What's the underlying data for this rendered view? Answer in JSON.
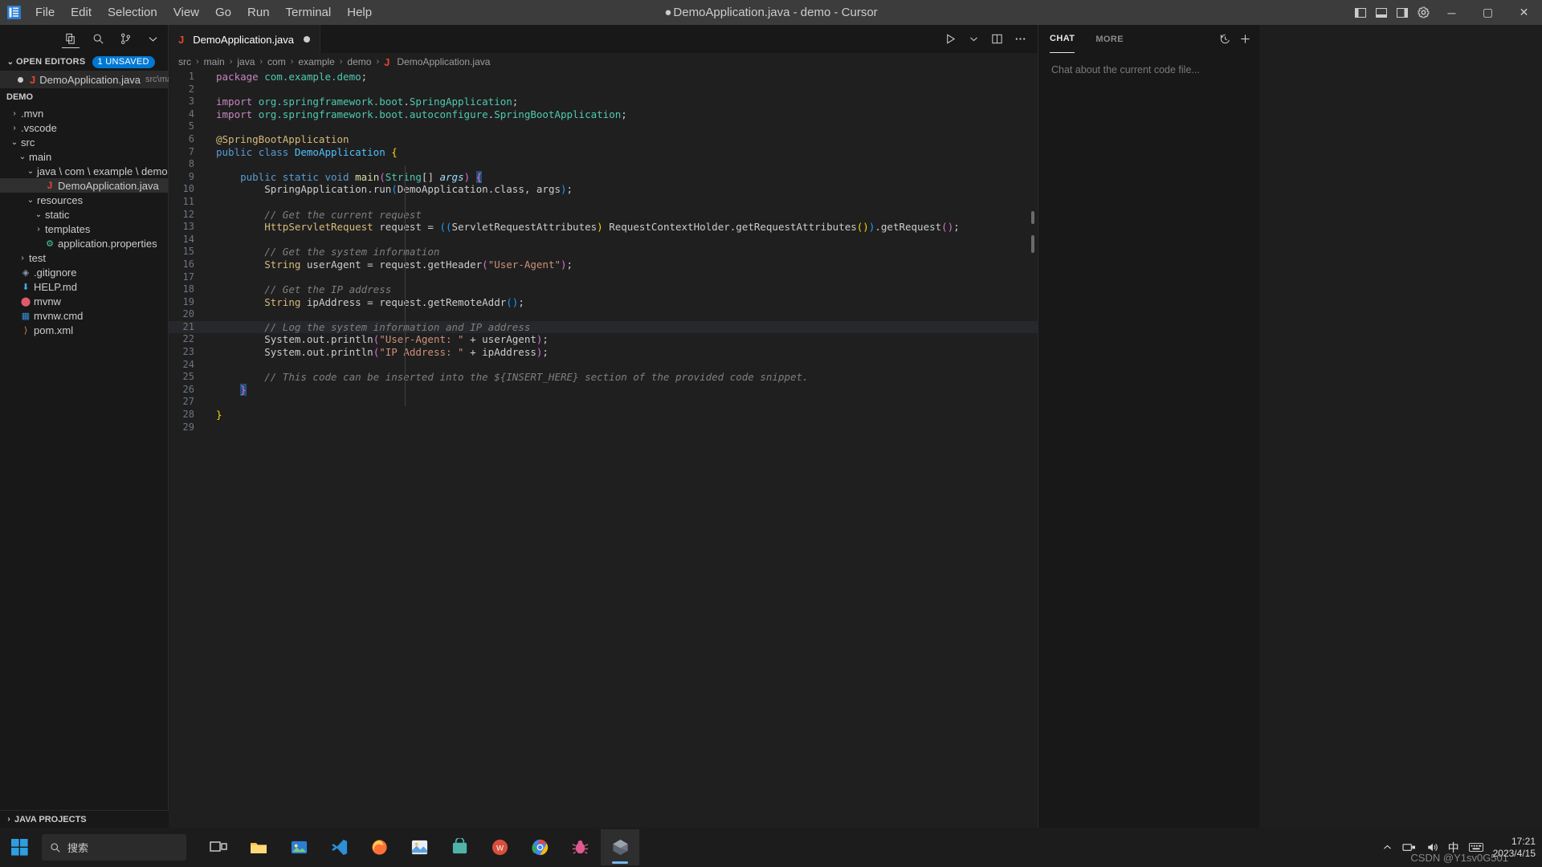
{
  "window": {
    "title": "DemoApplication.java - demo - Cursor",
    "dirty_marker": "●",
    "menu": [
      "File",
      "Edit",
      "Selection",
      "View",
      "Go",
      "Run",
      "Terminal",
      "Help"
    ],
    "controls": {
      "minimize": "─",
      "maximize": "▢",
      "close": "✕"
    }
  },
  "sidebar": {
    "tools": [
      "new-file-icon",
      "search-icon",
      "source-control-icon",
      "more-icon"
    ],
    "open_editors": {
      "title": "OPEN EDITORS",
      "badge": "1 unsaved",
      "items": [
        {
          "name": "DemoApplication.java",
          "path_hint": "src\\main\\...",
          "dirty": true
        }
      ]
    },
    "project": {
      "root": "DEMO",
      "tree": [
        {
          "label": ".mvn",
          "type": "folder",
          "expanded": false,
          "depth": 1
        },
        {
          "label": ".vscode",
          "type": "folder",
          "expanded": false,
          "depth": 1
        },
        {
          "label": "src",
          "type": "folder",
          "expanded": true,
          "depth": 1
        },
        {
          "label": "main",
          "type": "folder",
          "expanded": true,
          "depth": 2
        },
        {
          "label": "java \\ com \\ example \\ demo",
          "type": "folder",
          "expanded": true,
          "depth": 3
        },
        {
          "label": "DemoApplication.java",
          "type": "java",
          "expanded": false,
          "depth": 4,
          "selected": true
        },
        {
          "label": "resources",
          "type": "folder",
          "expanded": true,
          "depth": 3
        },
        {
          "label": "static",
          "type": "folder",
          "expanded": true,
          "depth": 4
        },
        {
          "label": "templates",
          "type": "folder",
          "expanded": false,
          "depth": 4
        },
        {
          "label": "application.properties",
          "type": "properties",
          "expanded": false,
          "depth": 4
        },
        {
          "label": "test",
          "type": "folder",
          "expanded": false,
          "depth": 2
        },
        {
          "label": ".gitignore",
          "type": "git",
          "expanded": false,
          "depth": 1
        },
        {
          "label": "HELP.md",
          "type": "markdown",
          "expanded": false,
          "depth": 1
        },
        {
          "label": "mvnw",
          "type": "maven",
          "expanded": false,
          "depth": 1
        },
        {
          "label": "mvnw.cmd",
          "type": "windows",
          "expanded": false,
          "depth": 1
        },
        {
          "label": "pom.xml",
          "type": "xml",
          "expanded": false,
          "depth": 1
        }
      ]
    },
    "java_projects": "JAVA PROJECTS"
  },
  "editor": {
    "tab": {
      "label": "DemoApplication.java",
      "icon": "java-icon",
      "dirty": true
    },
    "actions": [
      "run-icon",
      "chevron-down-icon",
      "split-editor-icon",
      "more-actions-icon"
    ],
    "breadcrumb": [
      "src",
      "main",
      "java",
      "com",
      "example",
      "demo",
      "DemoApplication.java"
    ],
    "lines": [
      {
        "n": 1,
        "tokens": [
          {
            "t": "package ",
            "c": "t-key"
          },
          {
            "t": "com.example.demo",
            "c": "t-type"
          },
          {
            "t": ";",
            "c": "t-pl"
          }
        ]
      },
      {
        "n": 2,
        "tokens": []
      },
      {
        "n": 3,
        "tokens": [
          {
            "t": "import ",
            "c": "t-key"
          },
          {
            "t": "org.springframework.boot",
            "c": "t-type"
          },
          {
            "t": ".",
            "c": "t-pl"
          },
          {
            "t": "SpringApplication",
            "c": "t-type"
          },
          {
            "t": ";",
            "c": "t-pl"
          }
        ]
      },
      {
        "n": 4,
        "tokens": [
          {
            "t": "import ",
            "c": "t-key"
          },
          {
            "t": "org.springframework.boot.autoconfigure",
            "c": "t-type"
          },
          {
            "t": ".",
            "c": "t-pl"
          },
          {
            "t": "SpringBootApplication",
            "c": "t-type"
          },
          {
            "t": ";",
            "c": "t-pl"
          }
        ]
      },
      {
        "n": 5,
        "tokens": []
      },
      {
        "n": 6,
        "tokens": [
          {
            "t": "@SpringBootApplication",
            "c": "t-ann"
          }
        ]
      },
      {
        "n": 7,
        "tokens": [
          {
            "t": "public ",
            "c": "t-kw"
          },
          {
            "t": "class ",
            "c": "t-kw"
          },
          {
            "t": "DemoApplication",
            "c": "t-cls"
          },
          {
            "t": " ",
            "c": "t-pl"
          },
          {
            "t": "{",
            "c": "t-par1"
          }
        ]
      },
      {
        "n": 8,
        "tokens": []
      },
      {
        "n": 9,
        "tokens": [
          {
            "t": "    ",
            "c": "t-pl"
          },
          {
            "t": "public ",
            "c": "t-kw"
          },
          {
            "t": "static ",
            "c": "t-kw"
          },
          {
            "t": "void ",
            "c": "t-kw"
          },
          {
            "t": "main",
            "c": "t-fn"
          },
          {
            "t": "(",
            "c": "t-par2"
          },
          {
            "t": "String",
            "c": "t-type"
          },
          {
            "t": "[] ",
            "c": "t-pl"
          },
          {
            "t": "args",
            "c": "t-italic t-var"
          },
          {
            "t": ")",
            "c": "t-par2"
          },
          {
            "t": " ",
            "c": "t-pl"
          },
          {
            "t": "{",
            "c": "t-par2 cursor-brace"
          }
        ]
      },
      {
        "n": 10,
        "tokens": [
          {
            "t": "        ",
            "c": "t-pl"
          },
          {
            "t": "SpringApplication",
            "c": "t-pl"
          },
          {
            "t": ".",
            "c": "t-pl"
          },
          {
            "t": "run",
            "c": "t-pl"
          },
          {
            "t": "(",
            "c": "t-par3"
          },
          {
            "t": "DemoApplication",
            "c": "t-pl"
          },
          {
            "t": ".class, args",
            "c": "t-pl"
          },
          {
            "t": ")",
            "c": "t-par3"
          },
          {
            "t": ";",
            "c": "t-pl"
          }
        ]
      },
      {
        "n": 11,
        "tokens": []
      },
      {
        "n": 12,
        "tokens": [
          {
            "t": "        ",
            "c": "t-pl"
          },
          {
            "t": "// Get the current request",
            "c": "t-cmtg"
          }
        ]
      },
      {
        "n": 13,
        "tokens": [
          {
            "t": "        ",
            "c": "t-pl"
          },
          {
            "t": "HttpServletRequest",
            "c": "t-ann"
          },
          {
            "t": " request = ",
            "c": "t-pl"
          },
          {
            "t": "((",
            "c": "t-par3"
          },
          {
            "t": "ServletRequestAttributes",
            "c": "t-pl"
          },
          {
            "t": ")",
            "c": "t-par1"
          },
          {
            "t": " RequestContextHolder.getRequestAttributes",
            "c": "t-pl"
          },
          {
            "t": "()",
            "c": "t-par1"
          },
          {
            "t": ")",
            "c": "t-par3"
          },
          {
            "t": ".getRequest",
            "c": "t-pl"
          },
          {
            "t": "()",
            "c": "t-par2"
          },
          {
            "t": ";",
            "c": "t-pl"
          }
        ]
      },
      {
        "n": 14,
        "tokens": []
      },
      {
        "n": 15,
        "tokens": [
          {
            "t": "        ",
            "c": "t-pl"
          },
          {
            "t": "// Get the system information",
            "c": "t-cmtg"
          }
        ]
      },
      {
        "n": 16,
        "tokens": [
          {
            "t": "        ",
            "c": "t-pl"
          },
          {
            "t": "String",
            "c": "t-ann"
          },
          {
            "t": " userAgent = request.getHeader",
            "c": "t-pl"
          },
          {
            "t": "(",
            "c": "t-par2"
          },
          {
            "t": "\"User-Agent\"",
            "c": "t-str"
          },
          {
            "t": ")",
            "c": "t-par2"
          },
          {
            "t": ";",
            "c": "t-pl"
          }
        ]
      },
      {
        "n": 17,
        "tokens": []
      },
      {
        "n": 18,
        "tokens": [
          {
            "t": "        ",
            "c": "t-pl"
          },
          {
            "t": "// Get the IP address",
            "c": "t-cmtg"
          }
        ]
      },
      {
        "n": 19,
        "tokens": [
          {
            "t": "        ",
            "c": "t-pl"
          },
          {
            "t": "String",
            "c": "t-ann"
          },
          {
            "t": " ipAddress = request.getRemoteAddr",
            "c": "t-pl"
          },
          {
            "t": "()",
            "c": "t-par3"
          },
          {
            "t": ";",
            "c": "t-pl"
          }
        ]
      },
      {
        "n": 20,
        "tokens": []
      },
      {
        "n": 21,
        "tokens": [
          {
            "t": "        ",
            "c": "t-pl"
          },
          {
            "t": "// Log the system information and IP address",
            "c": "t-cmtg"
          }
        ],
        "highlight": true
      },
      {
        "n": 22,
        "tokens": [
          {
            "t": "        ",
            "c": "t-pl"
          },
          {
            "t": "System.out.println",
            "c": "t-pl"
          },
          {
            "t": "(",
            "c": "t-par2"
          },
          {
            "t": "\"User-Agent: \"",
            "c": "t-str"
          },
          {
            "t": " + userAgent",
            "c": "t-pl"
          },
          {
            "t": ")",
            "c": "t-par2"
          },
          {
            "t": ";",
            "c": "t-pl"
          }
        ]
      },
      {
        "n": 23,
        "tokens": [
          {
            "t": "        ",
            "c": "t-pl"
          },
          {
            "t": "System.out.println",
            "c": "t-pl"
          },
          {
            "t": "(",
            "c": "t-par2"
          },
          {
            "t": "\"IP Address: \"",
            "c": "t-str"
          },
          {
            "t": " + ipAddress",
            "c": "t-pl"
          },
          {
            "t": ")",
            "c": "t-par2"
          },
          {
            "t": ";",
            "c": "t-pl"
          }
        ]
      },
      {
        "n": 24,
        "tokens": []
      },
      {
        "n": 25,
        "tokens": [
          {
            "t": "        ",
            "c": "t-pl"
          },
          {
            "t": "// This code can be inserted into the ${INSERT_HERE} section of the provided code snippet.",
            "c": "t-cmtg"
          }
        ]
      },
      {
        "n": 26,
        "tokens": [
          {
            "t": "    ",
            "c": "t-pl"
          },
          {
            "t": "}",
            "c": "t-par2 cursor-brace"
          }
        ]
      },
      {
        "n": 27,
        "tokens": []
      },
      {
        "n": 28,
        "tokens": [
          {
            "t": "}",
            "c": "t-par1"
          }
        ]
      },
      {
        "n": 29,
        "tokens": []
      }
    ]
  },
  "chat": {
    "tabs": [
      {
        "label": "CHAT",
        "active": true
      },
      {
        "label": "MORE",
        "active": false
      }
    ],
    "icons": [
      "history-icon",
      "new-chat-icon"
    ],
    "placeholder": "Chat about the current code file..."
  },
  "taskbar": {
    "search_placeholder": "搜索",
    "apps": [
      "file-explorer-icon",
      "photos-app-icon",
      "vscode-icon",
      "firefox-icon",
      "paint-icon",
      "store-icon",
      "wps-icon",
      "chrome-icon",
      "bug-icon",
      "cursor-icon"
    ],
    "tray": [
      "chevron-up-icon",
      "network-icon",
      "volume-icon",
      "ime-icon"
    ],
    "ime": "中",
    "clock": {
      "time": "17:21",
      "date": "2023/4/15"
    },
    "watermark": "CSDN @Y1sv0G501"
  }
}
